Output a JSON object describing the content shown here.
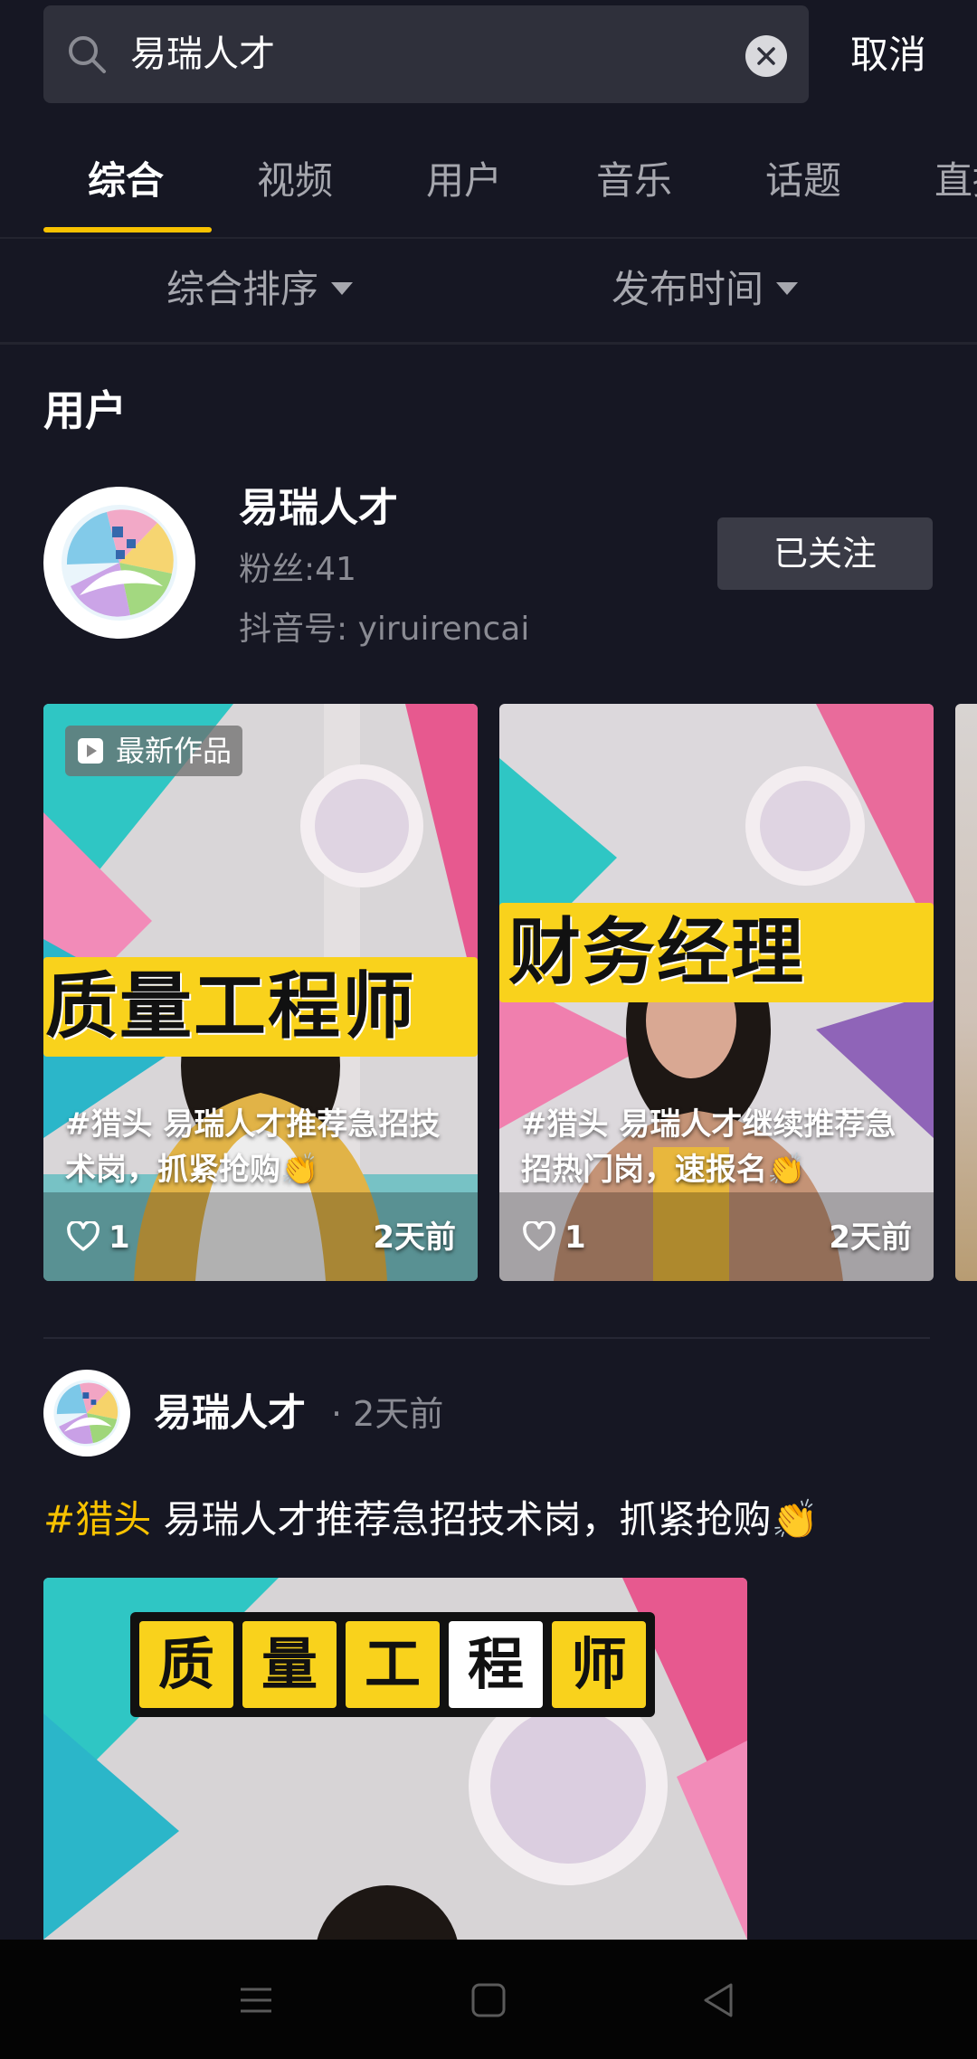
{
  "search": {
    "query": "易瑞人才",
    "cancel_label": "取消"
  },
  "tabs": [
    {
      "label": "综合",
      "active": true
    },
    {
      "label": "视频",
      "active": false
    },
    {
      "label": "用户",
      "active": false
    },
    {
      "label": "音乐",
      "active": false
    },
    {
      "label": "话题",
      "active": false
    },
    {
      "label": "直播",
      "active": false
    }
  ],
  "filters": {
    "sort_label": "综合排序",
    "time_label": "发布时间"
  },
  "user_section": {
    "title": "用户",
    "user": {
      "name": "易瑞人才",
      "fans": "粉丝:41",
      "douyin_id": "抖音号: yiruirencai",
      "follow_label": "已关注"
    }
  },
  "videos": [
    {
      "badge": "最新作品",
      "overlay_title": "质量工程师",
      "caption": "#猎头 易瑞人才推荐急招技术岗，抓紧抢购👏",
      "likes": "1",
      "time": "2天前"
    },
    {
      "overlay_title": "财务经理",
      "caption": "#猎头 易瑞人才继续推荐急招热门岗，速报名👏",
      "likes": "1",
      "time": "2天前"
    }
  ],
  "post": {
    "author": "易瑞人才",
    "time": "· 2天前",
    "hashtag": "#猎头",
    "text": " 易瑞人才推荐急招技术岗，抓紧抢购👏",
    "video_title_chars": [
      "质",
      "量",
      "工",
      "程",
      "师"
    ]
  },
  "colors": {
    "background": "#161723",
    "accent": "#f8c200",
    "secondary_text": "#a6a7ae",
    "button_bg": "#3a3b46"
  },
  "icons": {
    "search": "search-icon",
    "clear": "clear-icon",
    "heart": "heart-icon",
    "video_badge": "video-badge-icon",
    "nav_menu": "menu-icon",
    "nav_home": "home-square-icon",
    "nav_back": "back-triangle-icon"
  }
}
